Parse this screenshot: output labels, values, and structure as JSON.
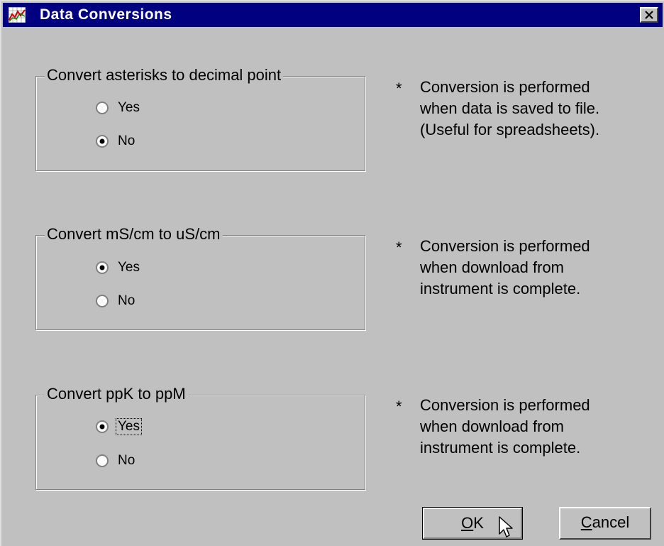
{
  "window": {
    "title": "Data Conversions"
  },
  "groups": [
    {
      "legend": "Convert asterisks to decimal point",
      "options": [
        {
          "label": "Yes",
          "selected": false
        },
        {
          "label": "No",
          "selected": true
        }
      ],
      "note_star": "*",
      "note": [
        "Conversion is performed",
        "when data is saved to file.",
        "(Useful for spreadsheets)."
      ]
    },
    {
      "legend": "Convert mS/cm to uS/cm",
      "options": [
        {
          "label": "Yes",
          "selected": true
        },
        {
          "label": "No",
          "selected": false
        }
      ],
      "note_star": "*",
      "note": [
        "Conversion is performed",
        "when download from",
        "instrument is complete."
      ]
    },
    {
      "legend": "Convert ppK to ppM",
      "options": [
        {
          "label": "Yes",
          "selected": true,
          "focused": true
        },
        {
          "label": "No",
          "selected": false
        }
      ],
      "note_star": "*",
      "note": [
        "Conversion is performed",
        "when download from",
        "instrument is complete."
      ]
    }
  ],
  "buttons": {
    "ok": {
      "mnemonic": "O",
      "rest": "K"
    },
    "cancel": {
      "mnemonic": "C",
      "rest": "ancel"
    }
  }
}
